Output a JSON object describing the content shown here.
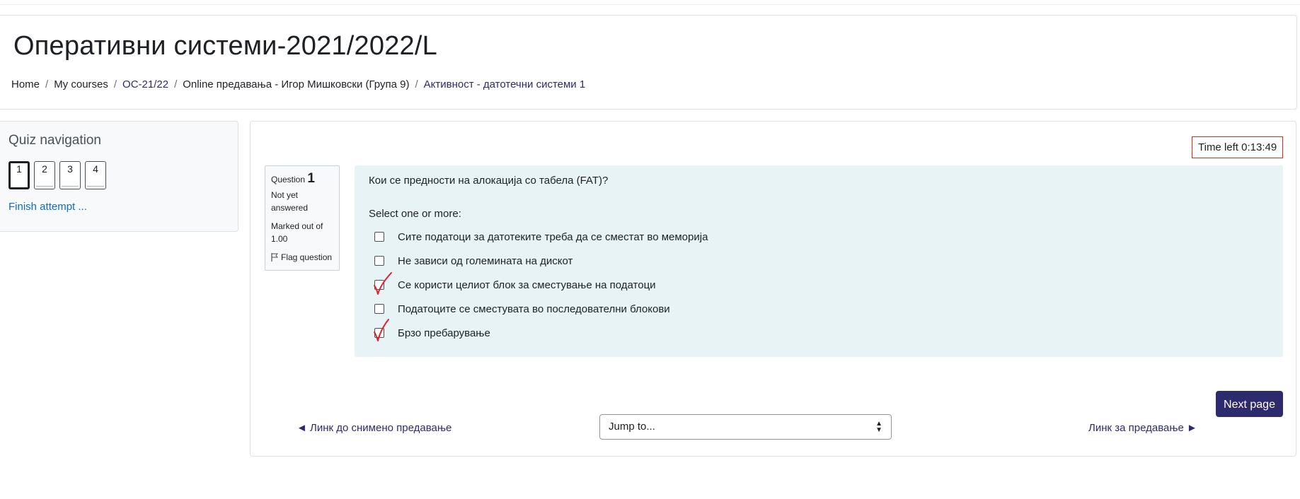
{
  "header": {
    "title": "Оперативни системи-2021/2022/L",
    "breadcrumb": [
      "Home",
      "My courses",
      "ОС-21/22",
      "Online предавања - Игор Мишковски (Група 9)",
      "Активност - датотечни системи 1"
    ]
  },
  "quiz_nav": {
    "title": "Quiz navigation",
    "buttons": [
      "1",
      "2",
      "3",
      "4"
    ],
    "current": "1",
    "finish_label": "Finish attempt ..."
  },
  "timer": {
    "text": "Time left 0:13:49"
  },
  "question": {
    "label": "Question",
    "number": "1",
    "state": "Not yet answered",
    "grade": "Marked out of 1.00",
    "flag_label": "Flag question",
    "text": "Кои се предности на алокација со табела (FAT)?",
    "prompt": "Select one or more:",
    "answers": [
      {
        "text": "Сите податоци за датотеките треба да се сместат во меморија",
        "hand_checkmark": false
      },
      {
        "text": "Не зависи од големината на дискот",
        "hand_checkmark": false
      },
      {
        "text": "Се користи целиот блок за сместување на податоци",
        "hand_checkmark": true
      },
      {
        "text": "Податоците се сместувата во последователни блокови",
        "hand_checkmark": false
      },
      {
        "text": "Брзо пребарување",
        "hand_checkmark": true
      }
    ]
  },
  "footer": {
    "next_page_label": "Next page",
    "prev_activity": "◄ Линк до снимено предавање",
    "jump_placeholder": "Jump to...",
    "next_activity": "Линк за предавање ►"
  },
  "colors": {
    "brand": "#2e2a6e",
    "question_bg": "#e7f3f5",
    "timer_border": "#ca3120",
    "annotation": "#e0202a"
  }
}
